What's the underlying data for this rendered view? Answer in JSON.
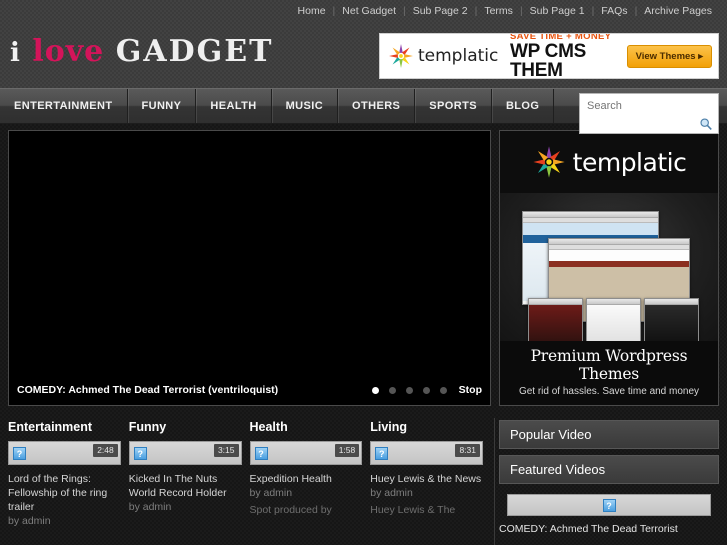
{
  "topnav": {
    "items": [
      {
        "label": "Home"
      },
      {
        "label": "Net Gadget"
      },
      {
        "label": "Sub Page 2"
      },
      {
        "label": "Terms"
      },
      {
        "label": "Sub Page 1"
      },
      {
        "label": "FAQs"
      },
      {
        "label": "Archive Pages"
      }
    ],
    "separator": "|"
  },
  "logo": {
    "word1": "i",
    "word2": "love",
    "word3": "GADGET",
    "accent_color": "#d4145a"
  },
  "banner": {
    "brand": "templatic",
    "line1": "SAVE TIME + MONEY",
    "line2": "WP CMS THEM",
    "button_label": "View Themes ▸",
    "line1_color": "#e8540f",
    "button_color": "#f2a006"
  },
  "mainnav": {
    "items": [
      {
        "label": "ENTERTAINMENT"
      },
      {
        "label": "FUNNY"
      },
      {
        "label": "HEALTH"
      },
      {
        "label": "MUSIC"
      },
      {
        "label": "OTHERS"
      },
      {
        "label": "SPORTS"
      },
      {
        "label": "BLOG"
      }
    ]
  },
  "search": {
    "placeholder": "Search",
    "value": "",
    "icon": "search-icon"
  },
  "player": {
    "title": "COMEDY: Achmed The Dead Terrorist (ventriloquist)",
    "stop_label": "Stop",
    "dots": 5,
    "active_dot": 0
  },
  "promo": {
    "brand": "templatic",
    "heading": "Premium Wordpress Themes",
    "subheading": "Get rid of hassles. Save time and money"
  },
  "categories": [
    {
      "heading": "Entertainment",
      "duration": "2:48",
      "video_title": "Lord of the Rings: Fellowship of the ring trailer",
      "byline": "by admin",
      "excerpt": ""
    },
    {
      "heading": "Funny",
      "duration": "3:15",
      "video_title": "Kicked In The Nuts World Record Holder",
      "byline": "by admin",
      "excerpt": ""
    },
    {
      "heading": "Health",
      "duration": "1:58",
      "video_title": "Expedition Health",
      "byline": "by admin",
      "excerpt": "Spot produced by"
    },
    {
      "heading": "Living",
      "duration": "8:31",
      "video_title": "Huey Lewis & the News",
      "byline": "by admin",
      "excerpt": "Huey Lewis & The"
    }
  ],
  "widgets": {
    "tab1": "Popular Video",
    "tab2": "Featured Videos",
    "featured_title": "COMEDY: Achmed The Dead Terrorist"
  },
  "icons": {
    "broken_image": "?",
    "star": "templatic-star-icon"
  }
}
